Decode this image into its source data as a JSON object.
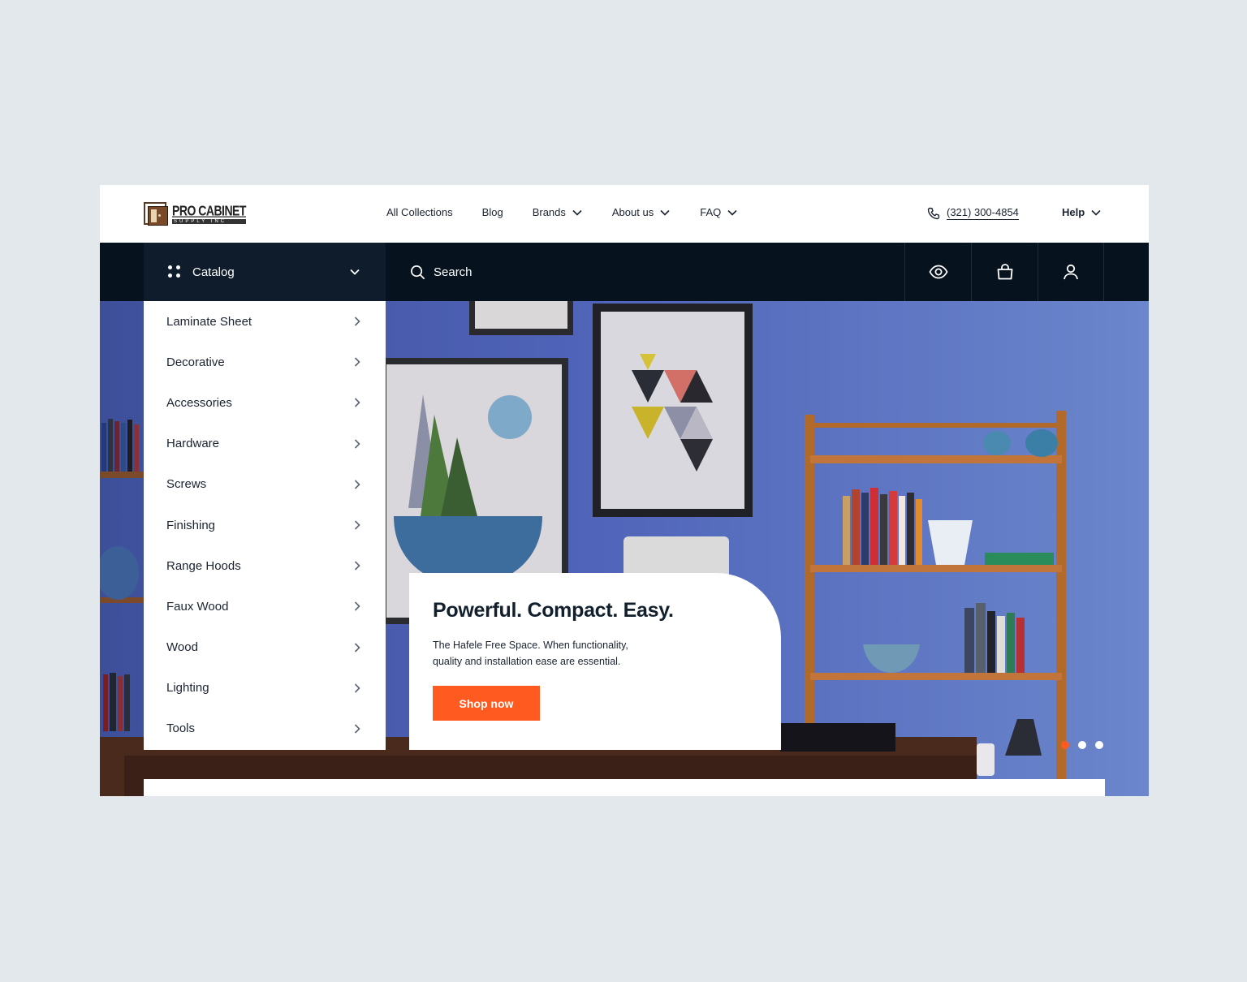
{
  "brand": {
    "line1": "PRO CABINET",
    "line2": "SUPPLY INC"
  },
  "nav": [
    {
      "label": "All Collections",
      "dropdown": false
    },
    {
      "label": "Blog",
      "dropdown": false
    },
    {
      "label": "Brands",
      "dropdown": true
    },
    {
      "label": "About us",
      "dropdown": true
    },
    {
      "label": "FAQ",
      "dropdown": true
    }
  ],
  "phone": "(321) 300-4854",
  "help": "Help",
  "catalog": {
    "label": "Catalog"
  },
  "search": {
    "placeholder": "Search"
  },
  "icons": [
    "eye-icon",
    "shopping-bag-icon",
    "user-icon"
  ],
  "categories": [
    "Laminate Sheet",
    "Decorative",
    "Accessories",
    "Hardware",
    "Screws",
    "Finishing",
    "Range Hoods",
    "Faux Wood",
    "Wood",
    "Lighting",
    "Tools"
  ],
  "promo": {
    "title": "Powerful. Compact. Easy.",
    "body": "The Hafele Free Space. When functionality, quality and installation ease are essential.",
    "cta": "Shop now"
  },
  "slider": {
    "count": 3,
    "active": 0
  },
  "colors": {
    "accent": "#ff5a1f",
    "dark": "#06131f",
    "wall": "#5a72c4"
  }
}
